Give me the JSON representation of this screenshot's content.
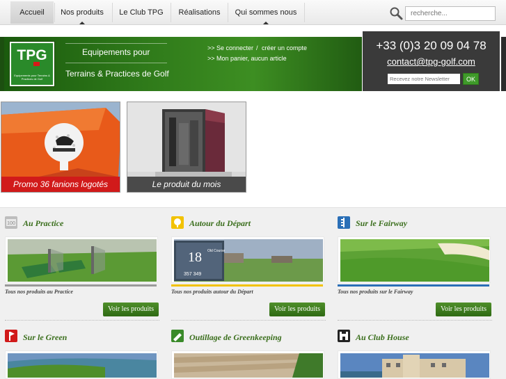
{
  "nav": {
    "items": [
      {
        "label": "Accueil"
      },
      {
        "label": "Nos produits"
      },
      {
        "label": "Le Club TPG"
      },
      {
        "label": "Réalisations"
      },
      {
        "label": "Qui sommes nous"
      }
    ],
    "search_placeholder": "recherche..."
  },
  "header": {
    "logo_text": "TPG",
    "logo_subtext": "Equipements pour Terrains & Practices de Golf",
    "tagline_line1": "Equipements pour",
    "tagline_line2": "Terrains & Practices de Golf",
    "login_link": ">> Se connecter",
    "separator": "/",
    "create_account_link": "créer un compte",
    "cart_link": ">> Mon panier, aucun article"
  },
  "contact": {
    "phone": "+33 (0)3 20 09 04 78",
    "email": "contact@tpg-golf.com",
    "newsletter_placeholder": "Recevez notre Newsletter",
    "ok_label": "OK"
  },
  "promos": [
    {
      "caption": "Promo 36 fanions logotés",
      "caption_color": "#d11a1a"
    },
    {
      "caption": "Le produit du mois",
      "caption_color": "#4a4a4a"
    }
  ],
  "categories": [
    {
      "title": "Au Practice",
      "description": "Tous nos produits au Practice",
      "button": "Voir les produits",
      "icon": "practice-icon",
      "underline_color": "#9a9a9a"
    },
    {
      "title": "Autour du Départ",
      "description": "Tous nos produits autour du Départ",
      "button": "Voir les produits",
      "icon": "tee-icon",
      "underline_color": "#f2c200"
    },
    {
      "title": "Sur le Fairway",
      "description": "Tous nos produits sur le Fairway",
      "button": "Voir les produits",
      "icon": "fairway-icon",
      "underline_color": "#2a6fb7"
    },
    {
      "title": "Sur le Green",
      "icon": "green-flag-icon"
    },
    {
      "title": "Outillage de Greenkeeping",
      "icon": "greenkeeping-icon"
    },
    {
      "title": "Au Club House",
      "icon": "clubhouse-icon"
    }
  ],
  "colors": {
    "brand_green": "#3a6e1c",
    "button_green": "#3f9a2a",
    "contact_bg": "#3a3a3a"
  }
}
